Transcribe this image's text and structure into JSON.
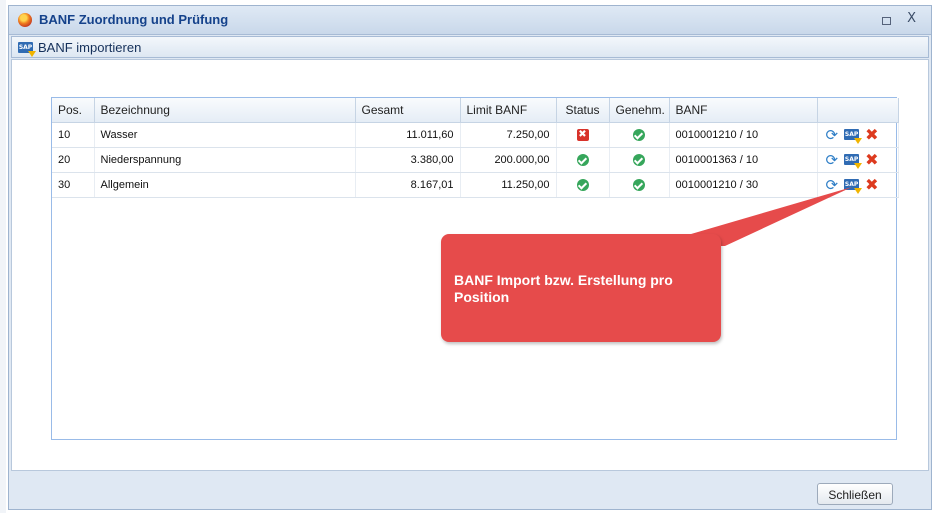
{
  "window": {
    "title": "BANF Zuordnung und Prüfung",
    "close_glyph": "X"
  },
  "toolbar": {
    "import_label": "BANF importieren",
    "sap_badge": "SAP"
  },
  "table": {
    "columns": [
      "Pos.",
      "Bezeichnung",
      "Gesamt",
      "Limit BANF",
      "Status",
      "Genehm.",
      "BANF",
      ""
    ],
    "rows": [
      {
        "pos": "10",
        "bezeichnung": "Wasser",
        "gesamt": "11.011,60",
        "limit": "7.250,00",
        "status": "error",
        "status_glyph": "✖",
        "genehm": "ok",
        "banf": "0010001210 / 10"
      },
      {
        "pos": "20",
        "bezeichnung": "Niederspannung",
        "gesamt": "3.380,00",
        "limit": "200.000,00",
        "status": "ok",
        "status_glyph": "",
        "genehm": "ok",
        "banf": "0010001363 / 10"
      },
      {
        "pos": "30",
        "bezeichnung": "Allgemein",
        "gesamt": "8.167,01",
        "limit": "11.250,00",
        "status": "ok",
        "status_glyph": "",
        "genehm": "ok",
        "banf": "0010001210 / 30"
      }
    ],
    "action_icons": {
      "refresh": "refresh-icon",
      "sap_import": "sap-import-icon",
      "delete": "delete-icon"
    },
    "refresh_glyph": "⟳",
    "delete_glyph": "✖"
  },
  "callout": {
    "text": "BANF Import bzw. Erstellung pro Position",
    "color": "#e64b4b"
  },
  "footer": {
    "close_label": "Schließen"
  }
}
